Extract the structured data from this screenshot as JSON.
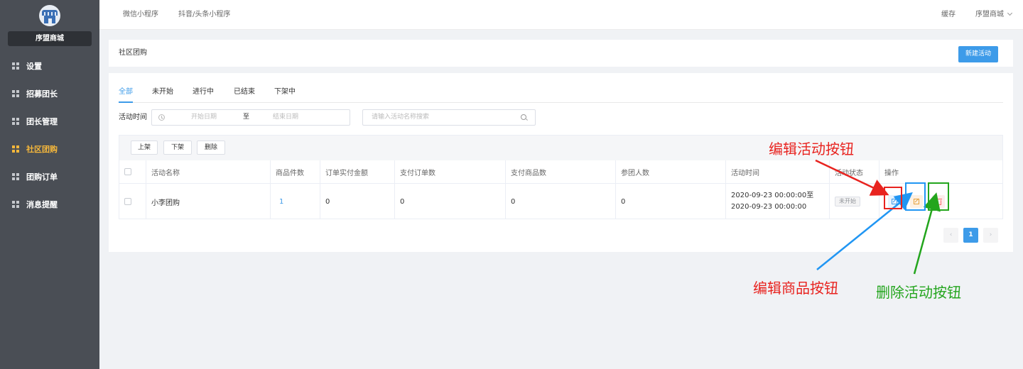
{
  "sidebar": {
    "shop_name": "序盟商城",
    "items": [
      {
        "label": "设置"
      },
      {
        "label": "招募团长"
      },
      {
        "label": "团长管理"
      },
      {
        "label": "社区团购",
        "active": true
      },
      {
        "label": "团购订单"
      },
      {
        "label": "消息提醒"
      }
    ]
  },
  "topbar": {
    "tabs": [
      "微信小程序",
      "抖音/头条小程序"
    ],
    "cache": "缓存",
    "account": "序盟商城"
  },
  "page": {
    "title": "社区团购",
    "new_button": "新建活动"
  },
  "status_tabs": [
    "全部",
    "未开始",
    "进行中",
    "已结束",
    "下架中"
  ],
  "filters": {
    "time_label": "活动时间",
    "start_placeholder": "开始日期",
    "separator": "至",
    "end_placeholder": "结束日期",
    "search_placeholder": "请输入活动名称搜索"
  },
  "bulk_actions": [
    "上架",
    "下架",
    "删除"
  ],
  "table": {
    "headers": [
      "活动名称",
      "商品件数",
      "订单实付金额",
      "支付订单数",
      "支付商品数",
      "参团人数",
      "活动时间",
      "活动状态",
      "操作"
    ],
    "rows": [
      {
        "name": "小李团购",
        "goods_count": "1",
        "paid_amount": "0",
        "paid_orders": "0",
        "paid_goods": "0",
        "participants": "0",
        "time_start": "2020-09-23 00:00:00至",
        "time_end": "2020-09-23 00:00:00",
        "status": "未开始"
      }
    ]
  },
  "pagination": {
    "current": "1",
    "prev": "‹",
    "next": "›"
  },
  "annotations": {
    "edit_activity": {
      "label": "编辑活动按钮",
      "color": "#e8231f"
    },
    "edit_goods": {
      "label": "编辑商品按钮",
      "color": "#2196f3"
    },
    "delete_activity": {
      "label": "删除活动按钮",
      "color": "#23a51d"
    }
  },
  "colors": {
    "accent": "#3d9be9",
    "sidebar_bg": "#4a4e55",
    "active_menu": "#f5b73b"
  }
}
